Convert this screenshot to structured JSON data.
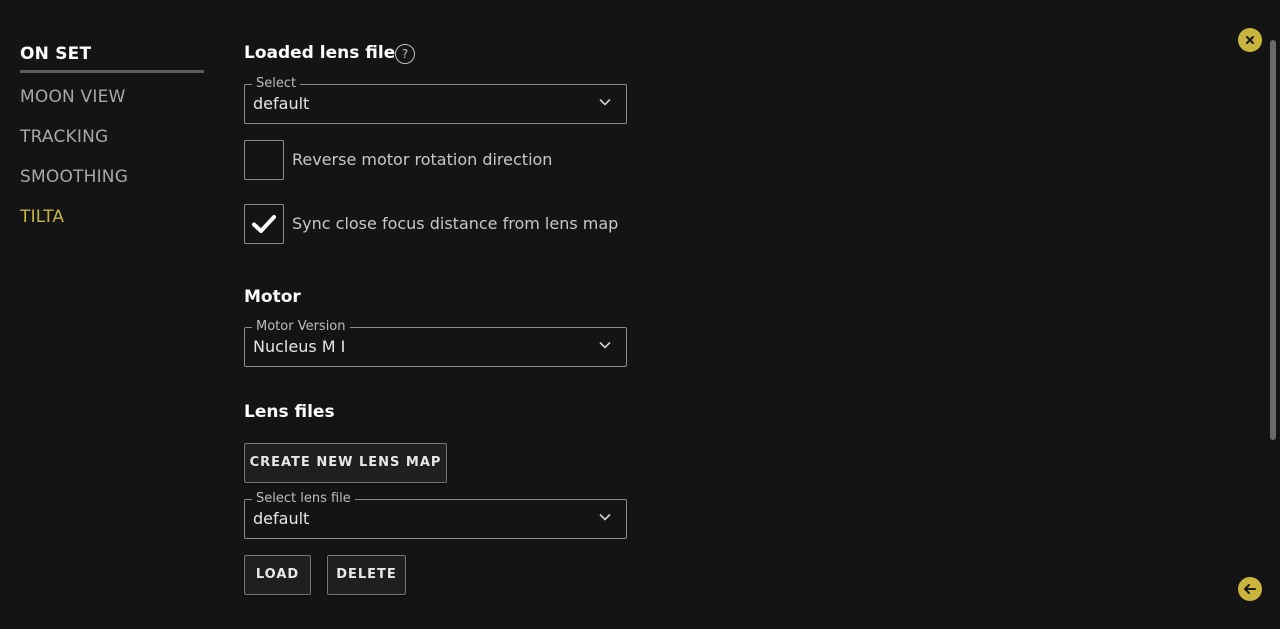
{
  "nav": {
    "items": [
      {
        "label": "ON SET"
      },
      {
        "label": "MOON VIEW"
      },
      {
        "label": "TRACKING"
      },
      {
        "label": "SMOOTHING"
      },
      {
        "label": "TILTA"
      }
    ]
  },
  "lens_file": {
    "heading": "Loaded lens file",
    "help_icon": "?",
    "select_label": "Select",
    "select_value": "default"
  },
  "options": {
    "reverse_label": "Reverse motor rotation direction",
    "reverse_checked": false,
    "sync_label": "Sync close focus distance from lens map",
    "sync_checked": true
  },
  "motor": {
    "heading": "Motor",
    "version_label": "Motor Version",
    "version_value": "Nucleus M I"
  },
  "lens_files": {
    "heading": "Lens files",
    "create_button": "CREATE NEW LENS MAP",
    "select_label": "Select lens file",
    "select_value": "default",
    "load_button": "LOAD",
    "delete_button": "DELETE"
  },
  "icons": {
    "close": "close-icon",
    "back": "arrow-left-icon",
    "chevron": "chevron-down-icon",
    "check": "check-icon"
  },
  "colors": {
    "background": "#141414",
    "accent": "#c9b53e",
    "nav_inactive": "#a8a8a8"
  }
}
